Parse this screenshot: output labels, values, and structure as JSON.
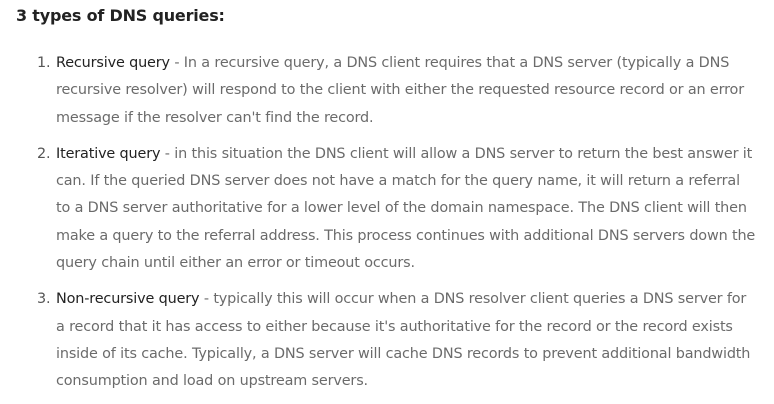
{
  "heading": "3 types of DNS queries:",
  "items": [
    {
      "number": "1.",
      "term": "Recursive query",
      "text": " - In a recursive query, a DNS client requires that a DNS server (typically a DNS recursive resolver) will respond to the client with either the requested resource record or an error message if the resolver can't find the record."
    },
    {
      "number": "2.",
      "term": "Iterative query",
      "text": " - in this situation the DNS client will allow a DNS server to return the best answer it can. If the queried DNS server does not have a match for the query name, it will return a referral to a DNS server authoritative for a lower level of the domain namespace. The DNS client will then make a query to the referral address. This process continues with additional DNS servers down the query chain until either an error or timeout occurs."
    },
    {
      "number": "3.",
      "term": "Non-recursive query",
      "text": " - typically this will occur when a DNS resolver client queries a DNS server for a record that it has access to either because it's authoritative for the record or the record exists inside of its cache. Typically, a DNS server will cache DNS records to prevent additional bandwidth consumption and load on upstream servers."
    }
  ]
}
